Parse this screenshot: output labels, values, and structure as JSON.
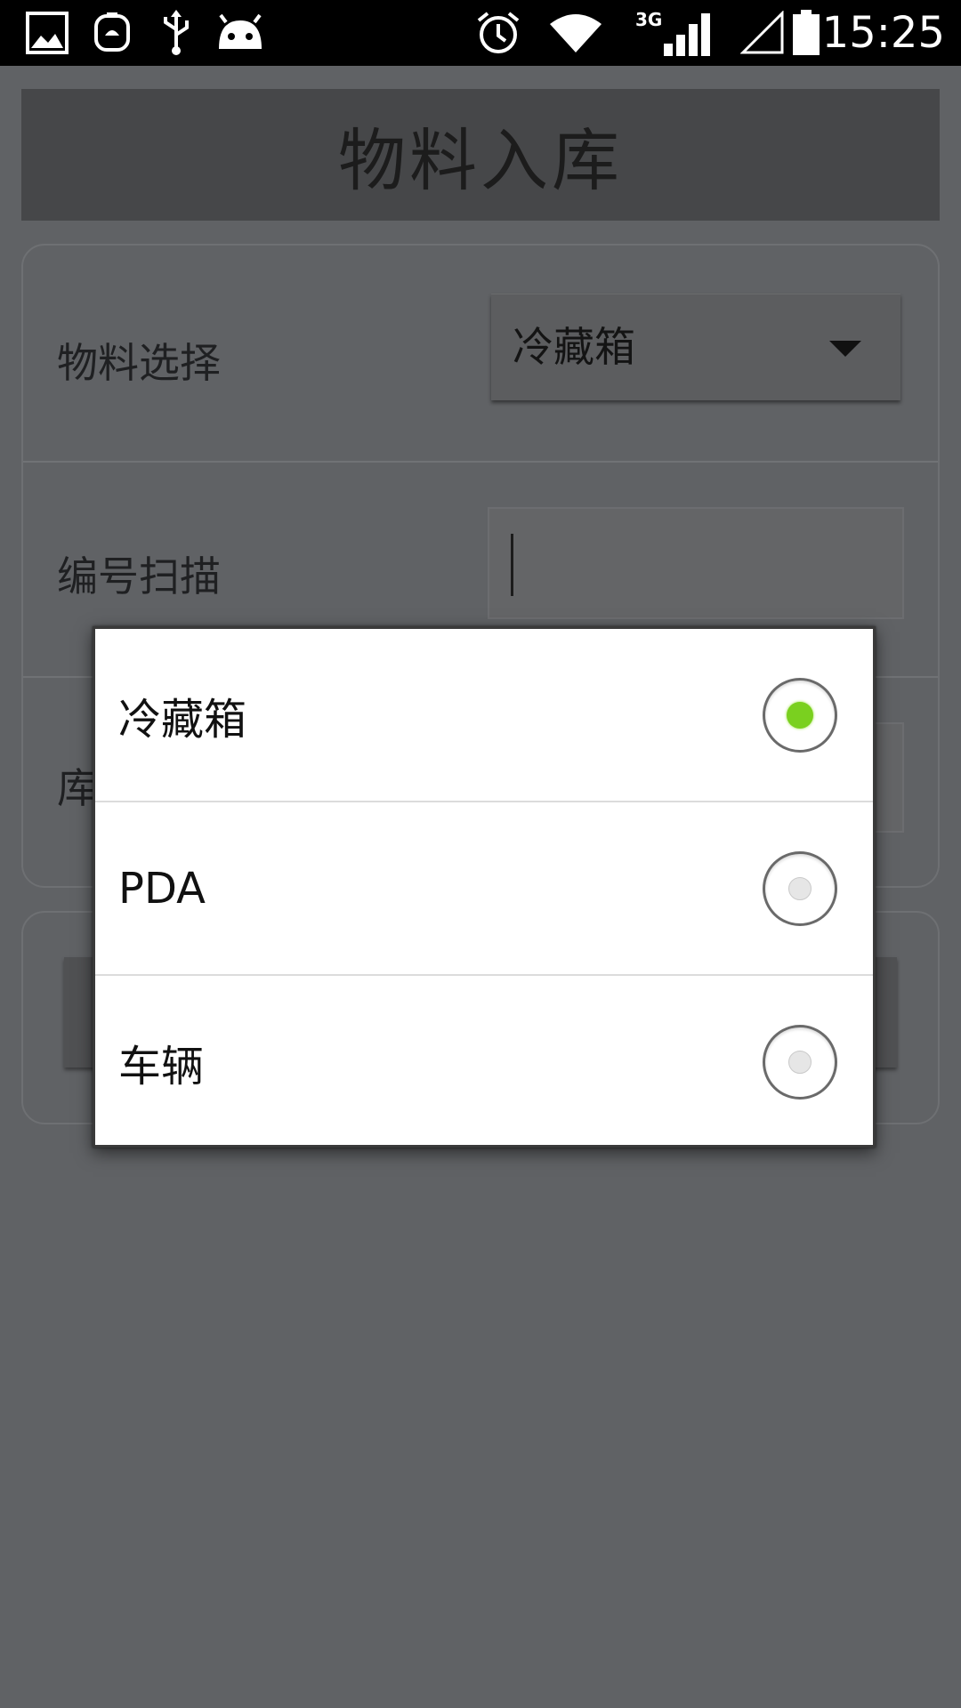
{
  "status_bar": {
    "time": "15:25",
    "network_type": "3G",
    "icons": [
      "gallery-icon",
      "huawei-icon",
      "usb-icon",
      "android-icon",
      "alarm-icon",
      "wifi-icon",
      "signal-icon",
      "signal-empty-icon",
      "battery-icon"
    ]
  },
  "app": {
    "title": "物料入库",
    "form": {
      "material_label": "物料选择",
      "material_value": "冷藏箱",
      "scan_label": "编号扫描",
      "scan_value": "",
      "warehouse_label_partial": "库"
    }
  },
  "dialog": {
    "options": [
      {
        "label": "冷藏箱",
        "selected": true
      },
      {
        "label": "PDA",
        "selected": false
      },
      {
        "label": "车辆",
        "selected": false
      }
    ],
    "selected_color": "#7ad01f"
  }
}
